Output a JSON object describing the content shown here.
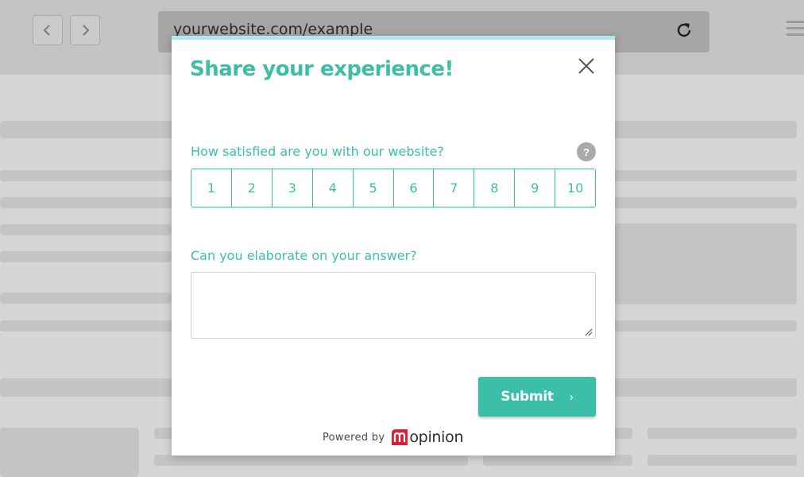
{
  "browser": {
    "url": "yourwebsite.com/example",
    "back_icon": "chevron-left-icon",
    "forward_icon": "chevron-right-icon",
    "reload_icon": "reload-icon",
    "menu_icon": "hamburger-menu-icon"
  },
  "modal": {
    "title": "Share your experience!",
    "close_icon": "close-icon",
    "question1": {
      "label": "How satisfied are you with our website?",
      "help": "?",
      "scale": [
        "1",
        "2",
        "3",
        "4",
        "5",
        "6",
        "7",
        "8",
        "9",
        "10"
      ]
    },
    "question2": {
      "label": "Can you elaborate on your answer?",
      "value": "",
      "placeholder": ""
    },
    "submit": {
      "label": "Submit",
      "chevron": "›"
    },
    "footer": {
      "powered_by": "Powered by",
      "brand": "opinion",
      "brand_logo_letter": "m"
    }
  },
  "colors": {
    "accent": "#3bbfa8",
    "accent_bar": "#b5e6ef",
    "brand_red": "#d6213a",
    "overlay_bg": "#d6d6d6"
  }
}
